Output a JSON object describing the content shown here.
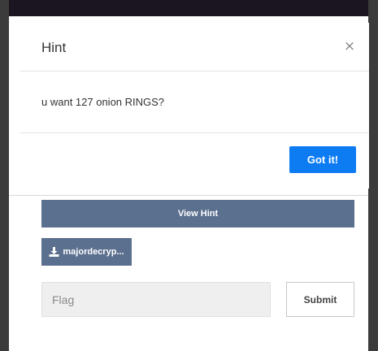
{
  "hint_modal": {
    "title": "Hint",
    "close_symbol": "×",
    "body_text": "u want 127 onion RINGS?",
    "confirm_label": "Got it!"
  },
  "challenge": {
    "view_hint_label": "View Hint",
    "file_label": "majordecryp...",
    "file_icon": "download-icon",
    "flag_placeholder": "Flag",
    "submit_label": "Submit"
  },
  "colors": {
    "accent": "#0d7cf2",
    "button_slate": "#5b6f8e",
    "backdrop": "#3b3b3b"
  }
}
